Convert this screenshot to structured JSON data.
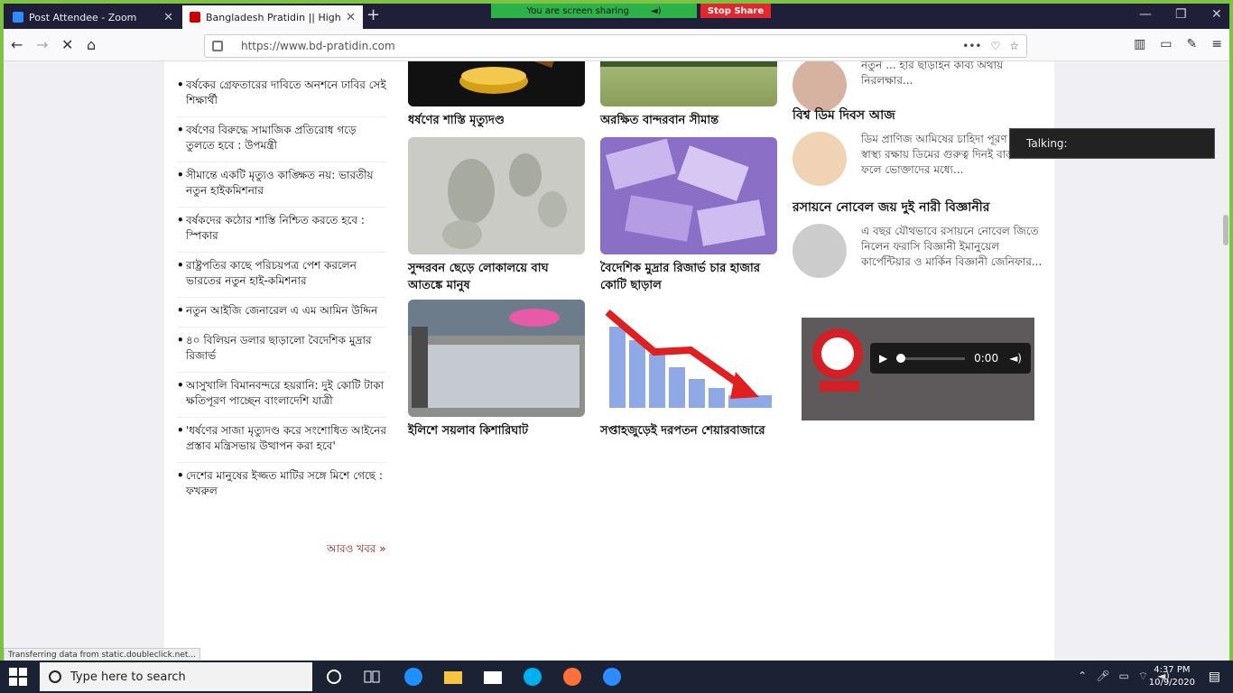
{
  "tabs": [
    {
      "title": "Post Attendee - Zoom"
    },
    {
      "title": "Bangladesh Pratidin || Highest"
    }
  ],
  "sharing": {
    "status": "You are screen sharing",
    "stop_label": "Stop Share"
  },
  "browser": {
    "url": "https://www.bd-pratidin.com"
  },
  "news_list": [
    "বর্ষকের গ্রেফতারের দাবিতে অনশনে ঢাবির সেই শিক্ষার্থী",
    "বর্ষণের বিরুদ্ধে সামাজিক প্রতিরোধ গড়ে তুলতে হবে : উপমন্ত্রী",
    "সীমান্তে একটি মৃত্যুও কাঙ্ক্ষিত নয়: ভারতীয় নতুন হাইকমিশনার",
    "বর্ষকদের কঠোর শাস্তি নিশ্চিত করতে হবে : স্পিকার",
    "রাষ্ট্রপতির কাছে পরিচয়পত্র পেশ করলেন ভারতের নতুন হাই-কমিশনার",
    "নতুন আইজি জেনারেল এ এম আমিন উদ্দিন",
    "৪০ বিলিয়ন ডলার ছাড়ালো বৈদেশিক মুদ্রার রিজার্ভ",
    "আসুখালি বিমানবন্দরে হয়রানি: দুই কোটি টাকা ক্ষতিপূরণ পাচ্ছেন বাংলাদেশি যাত্রী",
    "'ধর্ষণের সাজা মৃত্যুদণ্ড করে সংশোধিত আইনের প্রস্তাব মন্ত্রিসভায় উত্থাপন করা হবে'",
    "দেশের মানুষের ইজ্জত মাটির সঙ্গে মিশে গেছে : ফখরুল"
  ],
  "more_news": "আরও খবর »",
  "cards": [
    {
      "caption": "ধর্ষণের শাস্তি মৃত্যুদণ্ড"
    },
    {
      "caption": "অরক্ষিত বান্দরবান সীমান্ত"
    },
    {
      "caption": "সুন্দরবন ছেড়ে লোকালয়ে বাঘ আতঙ্কে মানুষ"
    },
    {
      "caption": "বৈদেশিক মুদ্রার রিজার্ভ চার হাজার কোটি ছাড়াল"
    },
    {
      "caption": "ইলিশে সয়লাব কিশারিঘাট"
    },
    {
      "caption": "সপ্তাহজুড়েই দরপতন শেয়ারবাজারে"
    }
  ],
  "side": {
    "top_text": "নতুন ... হার ছাড়াইন কাব্য অথায় নিরলক্ষার...",
    "egg_title": "বিশ্ব ডিম দিবস আজ",
    "egg_text": "ডিম প্রাণিজ আমিষের চাহিদা পূরণ করে। স্বাস্থ্য রক্ষায় ডিমের গুরুত্ব দিনই বাড়ছে। ফলে ভোক্তাদের মধ্যে...",
    "nobel_title": "রসায়নে নোবেল জয় দুই নারী বিজ্ঞানীর",
    "nobel_text": "এ বছর যৌথভাবে রসায়নে নোবেল জিতে নিলেন ফরাসি বিজ্ঞানী ইমানুয়েল কার্পেন্টিয়ার ও মার্কিন বিজ্ঞানী জেনিফার..."
  },
  "player": {
    "time": "0:00"
  },
  "talking": "Talking:",
  "status": "Transferring data from static.doubleclick.net...",
  "taskbar": {
    "search_placeholder": "Type here to search",
    "time": "4:37 PM",
    "date": "10/9/2020"
  }
}
